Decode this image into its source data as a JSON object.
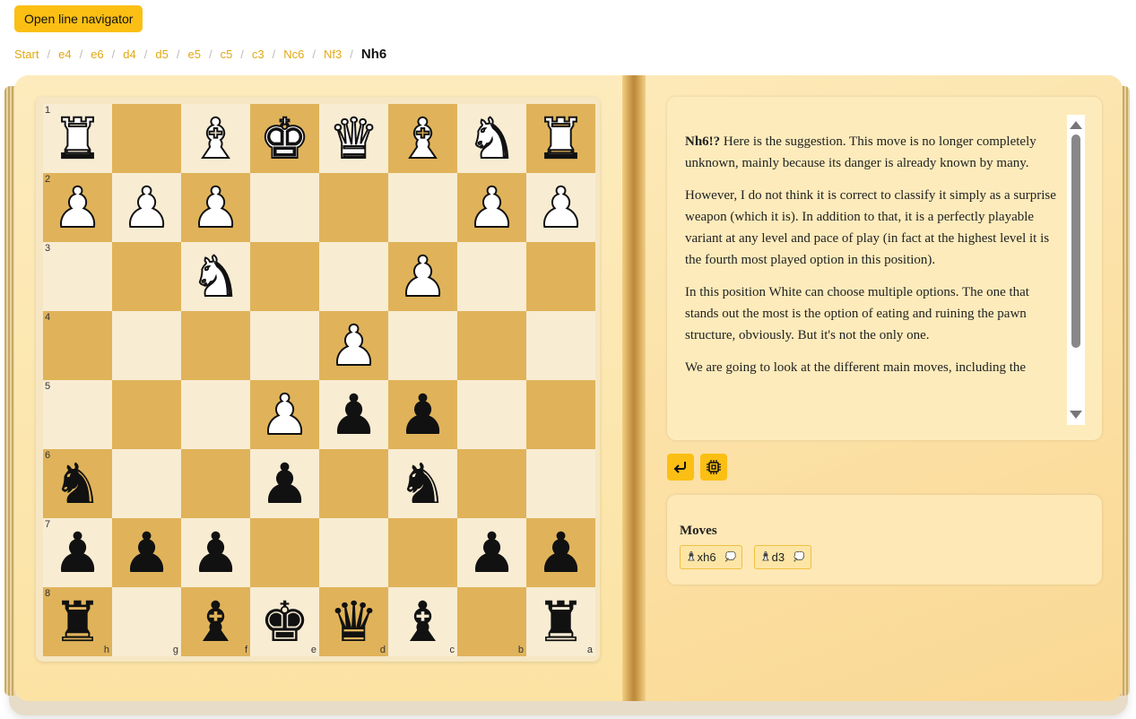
{
  "toolbar": {
    "open_navigator_label": "Open line navigator"
  },
  "breadcrumb": {
    "items": [
      "Start",
      "e4",
      "e6",
      "d4",
      "d5",
      "e5",
      "c5",
      "c3",
      "Nc6",
      "Nf3"
    ],
    "current": "Nh6",
    "separator": "/"
  },
  "board": {
    "ranks": [
      "1",
      "2",
      "3",
      "4",
      "5",
      "6",
      "7",
      "8"
    ],
    "files": [
      "h",
      "g",
      "f",
      "e",
      "d",
      "c",
      "b",
      "a"
    ],
    "rows": [
      [
        "wR",
        "",
        "wB",
        "wK",
        "wQ",
        "wB",
        "wN",
        "wR"
      ],
      [
        "wP",
        "wP",
        "wP",
        "",
        "",
        "",
        "wP",
        "wP"
      ],
      [
        "",
        "",
        "wN",
        "",
        "",
        "wP",
        "",
        ""
      ],
      [
        "",
        "",
        "",
        "",
        "wP",
        "",
        "",
        ""
      ],
      [
        "",
        "",
        "",
        "wP",
        "bP",
        "bP",
        "",
        ""
      ],
      [
        "bN",
        "",
        "",
        "bP",
        "",
        "bN",
        "",
        ""
      ],
      [
        "bP",
        "bP",
        "bP",
        "",
        "",
        "",
        "bP",
        "bP"
      ],
      [
        "bR",
        "",
        "bB",
        "bK",
        "bQ",
        "bB",
        "",
        "bR"
      ]
    ],
    "glyphs": {
      "K": "♚",
      "Q": "♛",
      "R": "♜",
      "B": "♝",
      "N": "♞",
      "P": "♟"
    },
    "colors": {
      "light": "#f8ecd3",
      "dark": "#e0b35a"
    }
  },
  "commentary": {
    "move": "Nh6!?",
    "paragraphs": [
      " Here is the suggestion. This move is no longer completely unknown, mainly because its danger is already known by many.",
      "However, I do not think it is correct to classify it simply as a surprise weapon (which it is). In addition to that, it is a perfectly playable variant at any level and pace of play (in fact at the highest level it is the fourth most played option in this position).",
      "In this position White can choose multiple options. The one that stands out the most is the option of eating and ruining the pawn structure, obviously. But it's not the only one.",
      "We are going to look at the different main moves, including the"
    ]
  },
  "actions": {
    "back_icon": "return-arrow-icon",
    "engine_icon": "chip-icon"
  },
  "moves": {
    "title": "Moves",
    "items": [
      {
        "label": "xh6",
        "piece_icon": "bishop-icon",
        "comment_icon": "speech-bubble-icon"
      },
      {
        "label": "d3",
        "piece_icon": "bishop-icon",
        "comment_icon": "speech-bubble-icon"
      }
    ]
  },
  "theme": {
    "accent": "#fbbf14",
    "link": "#e2a812"
  }
}
